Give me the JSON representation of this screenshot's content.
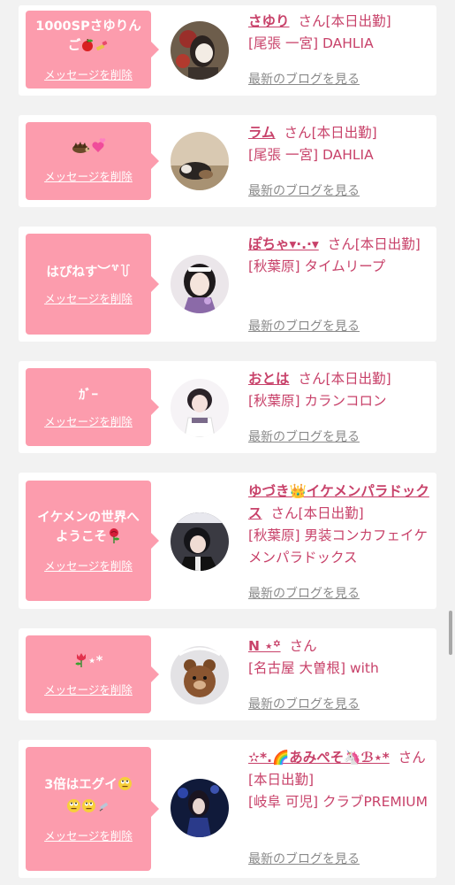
{
  "delete_label": "メッセージを削除",
  "blog_label": "最新のブログを見る",
  "san_label": "さん",
  "colors": {
    "bubble": "#fc9cad",
    "accent": "#c8426a",
    "link_gray": "#8a8a8a",
    "background": "#f2f2f2"
  },
  "entries": [
    {
      "message": "1000SPさゆりんご",
      "message_icons": [
        "apple-icon",
        "lipstick-icon"
      ],
      "name": "さゆり",
      "status": "[本日出勤]",
      "location": "[尾張 一宮] DAHLIA"
    },
    {
      "message": "",
      "message_icons": [
        "hedgehog-icon",
        "hearts-icon"
      ],
      "name": "ラム",
      "status": "[本日出勤]",
      "location": "[尾張 一宮] DAHLIA"
    },
    {
      "message": "はぴねす︶꒷꒦",
      "message_icons": [],
      "name": "ぽちゃ▾·.·▾",
      "status": "[本日出勤]",
      "location": "[秋葉原] タイムリープ"
    },
    {
      "message": "ｶﾞｰ",
      "message_icons": [],
      "name": "おとは",
      "status": "[本日出勤]",
      "location": "[秋葉原] カランコロン"
    },
    {
      "message": "イケメンの世界へようこそ",
      "message_icons": [
        "rose-icon"
      ],
      "name": "ゆづき👑イケメンパラドックス",
      "status": "[本日出勤]",
      "location": "[秋葉原] 男装コンカフェイケメンパラドックス"
    },
    {
      "message": "⋆*",
      "message_icons": [
        "tulip-icon"
      ],
      "name": "N ⋆꙳",
      "status": "",
      "location": "[名古屋 大曽根] with"
    },
    {
      "message": "3倍はエグイ",
      "message_icons": [
        "eyeroll-face-icon",
        "eyeroll-face-icon",
        "eyeroll-face-icon",
        "syringe-icon"
      ],
      "name": "✫*.🌈あみぺそ🦄ℬ⋆*",
      "status": "[本日出勤]",
      "location": "[岐阜 可児] クラブPREMIUM"
    }
  ]
}
